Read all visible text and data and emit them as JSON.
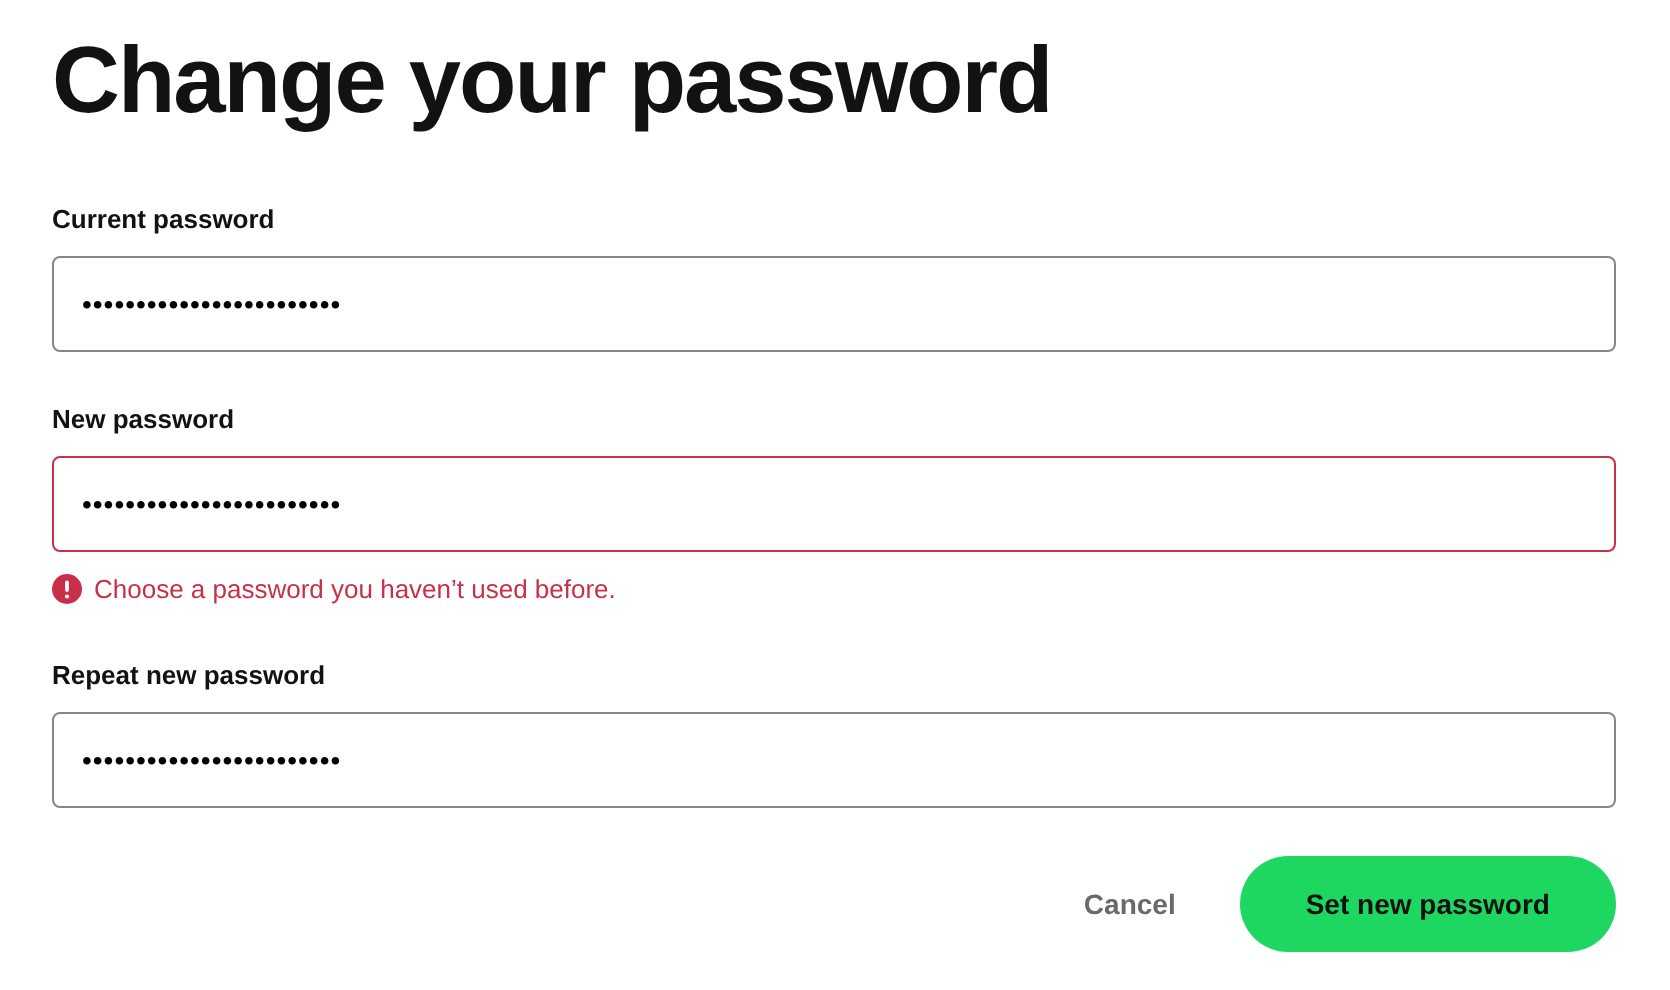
{
  "title": "Change your password",
  "fields": [
    {
      "label": "Current password",
      "value": "••••••••••••••••••••••••",
      "invalid": false
    },
    {
      "label": "New password",
      "value": "••••••••••••••••••••••••",
      "invalid": true,
      "error": "Choose a password you haven’t used before."
    },
    {
      "label": "Repeat new password",
      "value": "••••••••••••••••••••••••",
      "invalid": false
    }
  ],
  "buttons": [
    {
      "label": "Cancel",
      "kind": "secondary"
    },
    {
      "label": "Set new password",
      "kind": "primary"
    }
  ]
}
